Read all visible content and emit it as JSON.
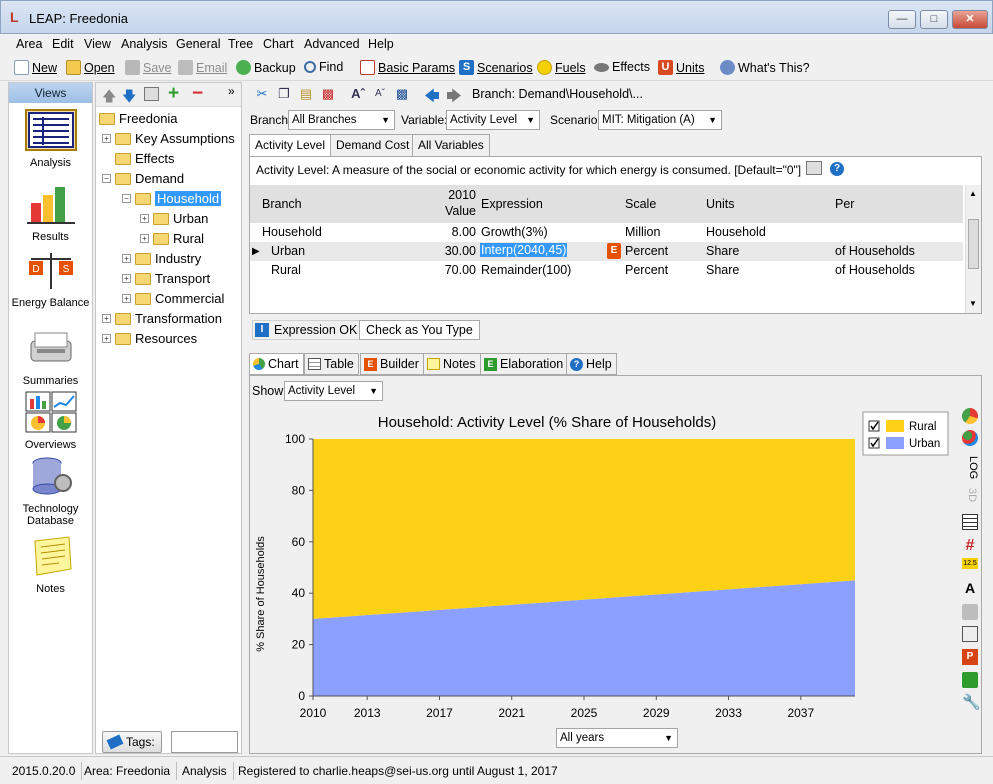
{
  "window": {
    "title": "LEAP: Freedonia",
    "controls": [
      "minimize",
      "maximize",
      "close"
    ]
  },
  "menu": [
    "Area",
    "Edit",
    "View",
    "Analysis",
    "General",
    "Tree",
    "Chart",
    "Advanced",
    "Help"
  ],
  "toolbar": {
    "new": "New",
    "open": "Open",
    "save": "Save",
    "email": "Email",
    "backup": "Backup",
    "find": "Find",
    "basic_params": "Basic Params",
    "scenarios": "Scenarios",
    "fuels": "Fuels",
    "effects": "Effects",
    "units": "Units",
    "whats_this": "What's This?"
  },
  "views": {
    "header": "Views",
    "items": [
      "Analysis",
      "Results",
      "Energy Balance",
      "Summaries",
      "Overviews",
      "Technology Database",
      "Notes"
    ]
  },
  "tree": {
    "root": "Freedonia",
    "nodes": [
      "Key Assumptions",
      "Effects",
      "Demand",
      "Household",
      "Urban",
      "Rural",
      "Industry",
      "Transport",
      "Commercial",
      "Transformation",
      "Resources"
    ],
    "selected": "Household",
    "tags_label": "Tags:"
  },
  "breadcrumb": "Branch: Demand\\Household\\...",
  "selectors": {
    "branch_label": "Branch:",
    "branch_value": "All Branches",
    "variable_label": "Variable:",
    "variable_value": "Activity Level",
    "scenario_label": "Scenario:",
    "scenario_value": "MIT: Mitigation (A)"
  },
  "tabs": [
    "Activity Level",
    "Demand Cost",
    "All Variables"
  ],
  "description": "Activity Level: A measure of the social or economic activity for which energy is consumed. [Default=\"0\"]",
  "grid": {
    "headers": {
      "branch": "Branch",
      "value_top": "2010",
      "value_bottom": "Value",
      "expression": "Expression",
      "scale": "Scale",
      "units": "Units",
      "per": "Per"
    },
    "rows": [
      {
        "branch": "Household",
        "value": "8.00",
        "expression": "Growth(3%)",
        "scale": "Million",
        "units": "Household",
        "per": ""
      },
      {
        "branch": "Urban",
        "value": "30.00",
        "expression": "Interp(2040,45)",
        "scale": "Percent",
        "units": "Share",
        "per": "of Households"
      },
      {
        "branch": "Rural",
        "value": "70.00",
        "expression": "Remainder(100)",
        "scale": "Percent",
        "units": "Share",
        "per": "of Households"
      }
    ]
  },
  "expression_status": "Expression OK",
  "check_as_you_type": "Check as You Type",
  "chart_tabs": [
    "Chart",
    "Table",
    "Builder",
    "Notes",
    "Elaboration",
    "Help"
  ],
  "show": {
    "label": "Show:",
    "value": "Activity Level"
  },
  "years_selector": "All years",
  "right_icons": {
    "log_label": "LOG",
    "3d_label": "3D",
    "badge_125": "12.5"
  },
  "chart_data": {
    "type": "area",
    "stacked": true,
    "title": "Household: Activity Level (% Share of Households)",
    "ylabel": "% Share of Households",
    "xlabel": "",
    "x": [
      2010,
      2011,
      2012,
      2013,
      2014,
      2015,
      2016,
      2017,
      2018,
      2019,
      2020,
      2021,
      2022,
      2023,
      2024,
      2025,
      2026,
      2027,
      2028,
      2029,
      2030,
      2031,
      2032,
      2033,
      2034,
      2035,
      2036,
      2037,
      2038,
      2039,
      2040
    ],
    "xticks": [
      2010,
      2013,
      2017,
      2021,
      2025,
      2029,
      2033,
      2037
    ],
    "ylim": [
      0,
      100
    ],
    "yticks": [
      0,
      20,
      40,
      60,
      80,
      100
    ],
    "series": [
      {
        "name": "Urban",
        "color": "#8ca0ff",
        "values": [
          30,
          30.5,
          31,
          31.5,
          32,
          32.5,
          33,
          33.5,
          34,
          34.5,
          35,
          35.5,
          36,
          36.5,
          37,
          37.5,
          38,
          38.5,
          39,
          39.5,
          40,
          40.5,
          41,
          41.5,
          42,
          42.5,
          43,
          43.5,
          44,
          44.5,
          45
        ]
      },
      {
        "name": "Rural",
        "color": "#fcd116",
        "values": [
          70,
          69.5,
          69,
          68.5,
          68,
          67.5,
          67,
          66.5,
          66,
          65.5,
          65,
          64.5,
          64,
          63.5,
          63,
          62.5,
          62,
          61.5,
          61,
          60.5,
          60,
          59.5,
          59,
          58.5,
          58,
          57.5,
          57,
          56.5,
          56,
          55.5,
          55
        ]
      }
    ],
    "legend": {
      "position": "top-right",
      "entries": [
        "Rural",
        "Urban"
      ]
    }
  },
  "statusbar": {
    "version": "2015.0.20.0",
    "area": "Area: Freedonia",
    "view": "Analysis",
    "registration": "Registered to charlie.heaps@sei-us.org until August 1, 2017"
  }
}
